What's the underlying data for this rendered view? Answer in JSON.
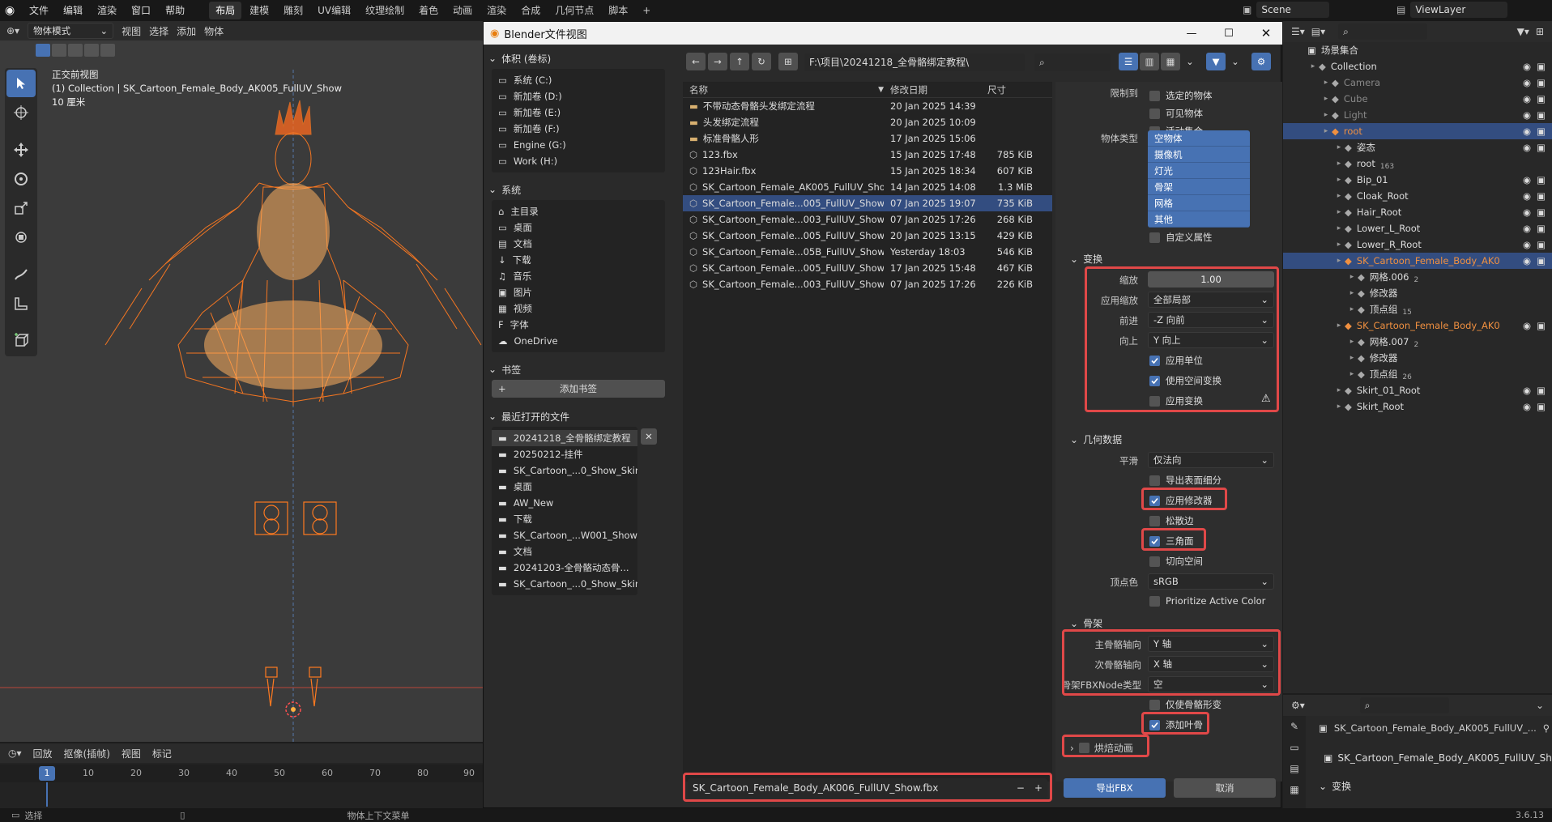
{
  "topbar": {
    "menus": [
      "文件",
      "编辑",
      "渲染",
      "窗口",
      "帮助"
    ],
    "workspaces": [
      "布局",
      "建模",
      "雕刻",
      "UV编辑",
      "纹理绘制",
      "着色",
      "动画",
      "渲染",
      "合成",
      "几何节点",
      "脚本"
    ],
    "active_workspace": "布局",
    "scene": "Scene",
    "view_layer": "ViewLayer"
  },
  "viewport": {
    "mode": "物体模式",
    "menus": [
      "视图",
      "选择",
      "添加",
      "物体"
    ],
    "overlay_view": "正交前视图",
    "overlay_collection": "(1) Collection | SK_Cartoon_Female_Body_AK005_FullUV_Show",
    "overlay_scale": "10 厘米"
  },
  "timeline": {
    "menus": [
      "回放",
      "抠像(插帧)",
      "视图",
      "标记"
    ],
    "current_frame": "1",
    "ticks": [
      "10",
      "20",
      "30",
      "40",
      "50",
      "60",
      "70",
      "80",
      "90"
    ]
  },
  "statusbar": {
    "left": "选择",
    "mid": "物体上下文菜单",
    "version": "3.6.13"
  },
  "dialog": {
    "title": "Blender文件视图",
    "volumes_header": "体积 (卷标)",
    "volumes": [
      "系统 (C:)",
      "新加卷 (D:)",
      "新加卷 (E:)",
      "新加卷 (F:)",
      "Engine (G:)",
      "Work (H:)"
    ],
    "system_header": "系统",
    "system_items": [
      "主目录",
      "桌面",
      "文档",
      "下载",
      "音乐",
      "图片",
      "视频",
      "字体",
      "OneDrive"
    ],
    "bookmarks_header": "书签",
    "add_bookmark": "添加书签",
    "recent_header": "最近打开的文件",
    "recent_items": [
      "20241218_全骨骼绑定教程",
      "20250212-挂件",
      "SK_Cartoon_...0_Show_Skin",
      "桌面",
      "AW_New",
      "下载",
      "SK_Cartoon_...W001_Show",
      "文档",
      "20241203-全骨骼动态骨...",
      "SK_Cartoon_...0_Show_Skin"
    ],
    "path": "F:\\项目\\20241218_全骨骼绑定教程\\",
    "columns": {
      "name": "名称",
      "date": "修改日期",
      "size": "尺寸"
    },
    "files": [
      {
        "name": "不带动态骨骼头发绑定流程",
        "date": "20 Jan 2025 14:39",
        "size": "",
        "folder": true
      },
      {
        "name": "头发绑定流程",
        "date": "20 Jan 2025 10:09",
        "size": "",
        "folder": true
      },
      {
        "name": "标准骨骼人形",
        "date": "17 Jan 2025 15:06",
        "size": "",
        "folder": true
      },
      {
        "name": "123.fbx",
        "date": "15 Jan 2025 17:48",
        "size": "785 KiB",
        "folder": false
      },
      {
        "name": "123Hair.fbx",
        "date": "15 Jan 2025 18:34",
        "size": "607 KiB",
        "folder": false
      },
      {
        "name": "SK_Cartoon_Female_AK005_FullUV_Sho...",
        "date": "14 Jan 2025 14:08",
        "size": "1.3 MiB",
        "folder": false
      },
      {
        "name": "SK_Cartoon_Female...005_FullUV_Show.fbx",
        "date": "07 Jan 2025 19:07",
        "size": "735 KiB",
        "folder": false,
        "selected": true
      },
      {
        "name": "SK_Cartoon_Female...003_FullUV_Show.fbx",
        "date": "07 Jan 2025 17:26",
        "size": "268 KiB",
        "folder": false
      },
      {
        "name": "SK_Cartoon_Female...005_FullUV_Show.fbx",
        "date": "20 Jan 2025 13:15",
        "size": "429 KiB",
        "folder": false
      },
      {
        "name": "SK_Cartoon_Female...05B_FullUV_Show.fbx",
        "date": "Yesterday 18:03",
        "size": "546 KiB",
        "folder": false
      },
      {
        "name": "SK_Cartoon_Female...005_FullUV_Show.fbx",
        "date": "17 Jan 2025 15:48",
        "size": "467 KiB",
        "folder": false
      },
      {
        "name": "SK_Cartoon_Female...003_FullUV_Show.fbx",
        "date": "07 Jan 2025 17:26",
        "size": "226 KiB",
        "folder": false
      }
    ],
    "filename": "SK_Cartoon_Female_Body_AK006_FullUV_Show.fbx",
    "export_button": "导出FBX",
    "cancel_button": "取消",
    "options": {
      "limit_label": "限制到",
      "limit": [
        "选定的物体",
        "可见物体",
        "活动集合"
      ],
      "obj_type_label": "物体类型",
      "obj_types": [
        "空物体",
        "摄像机",
        "灯光",
        "骨架",
        "网格",
        "其他"
      ],
      "custom_props": "自定义属性",
      "transform_header": "变换",
      "scale_label": "缩放",
      "scale_value": "1.00",
      "apply_scaling_label": "应用缩放",
      "apply_scaling_value": "全部局部",
      "forward_label": "前进",
      "forward_value": "-Z 向前",
      "up_label": "向上",
      "up_value": "Y 向上",
      "apply_unit": "应用单位",
      "use_space_transform": "使用空间变换",
      "apply_transform": "应用变换",
      "geometry_header": "几何数据",
      "smooth_label": "平滑",
      "smooth_value": "仅法向",
      "export_subdiv": "导出表面细分",
      "apply_modifiers": "应用修改器",
      "loose_edges": "松散边",
      "triangulate": "三角面",
      "tangent_space": "切向空间",
      "vertex_color_label": "顶点色",
      "vertex_color_value": "sRGB",
      "prioritize_color": "Prioritize Active Color",
      "armature_header": "骨架",
      "primary_axis_label": "主骨骼轴向",
      "primary_axis_value": "Y 轴",
      "secondary_axis_label": "次骨骼轴向",
      "secondary_axis_value": "X 轴",
      "node_type_label": "骨架FBXNode类型",
      "node_type_value": "空",
      "only_deform": "仅使骨骼形变",
      "add_leaf": "添加叶骨",
      "bake_anim": "烘焙动画"
    }
  },
  "outliner": {
    "root_label": "场景集合",
    "rows": [
      {
        "label": "Collection",
        "indent": 1
      },
      {
        "label": "Camera",
        "indent": 2,
        "dim": true
      },
      {
        "label": "Cube",
        "indent": 2,
        "dim": true
      },
      {
        "label": "Light",
        "indent": 2,
        "dim": true
      },
      {
        "label": "root",
        "indent": 2,
        "hl": true,
        "orange": true
      },
      {
        "label": "姿态",
        "indent": 3
      },
      {
        "label": "root",
        "indent": 3,
        "badge": "163"
      },
      {
        "label": "Bip_01",
        "indent": 3
      },
      {
        "label": "Cloak_Root",
        "indent": 3
      },
      {
        "label": "Hair_Root",
        "indent": 3
      },
      {
        "label": "Lower_L_Root",
        "indent": 3
      },
      {
        "label": "Lower_R_Root",
        "indent": 3
      },
      {
        "label": "SK_Cartoon_Female_Body_AK0",
        "indent": 3,
        "hl": true,
        "orange": true
      },
      {
        "label": "网格.006",
        "indent": 4,
        "badge": "2"
      },
      {
        "label": "修改器",
        "indent": 4
      },
      {
        "label": "顶点组",
        "indent": 4,
        "badge": "15"
      },
      {
        "label": "SK_Cartoon_Female_Body_AK0",
        "indent": 3,
        "orange": true
      },
      {
        "label": "网格.007",
        "indent": 4,
        "badge": "2"
      },
      {
        "label": "修改器",
        "indent": 4
      },
      {
        "label": "顶点组",
        "indent": 4,
        "badge": "26"
      },
      {
        "label": "Skirt_01_Root",
        "indent": 3
      },
      {
        "label": "Skirt_Root",
        "indent": 3
      }
    ]
  },
  "properties": {
    "object_name": "SK_Cartoon_Female_Body_AK005_FullUV_...",
    "object_field": "SK_Cartoon_Female_Body_AK005_FullUV_Show",
    "section": "变换"
  }
}
